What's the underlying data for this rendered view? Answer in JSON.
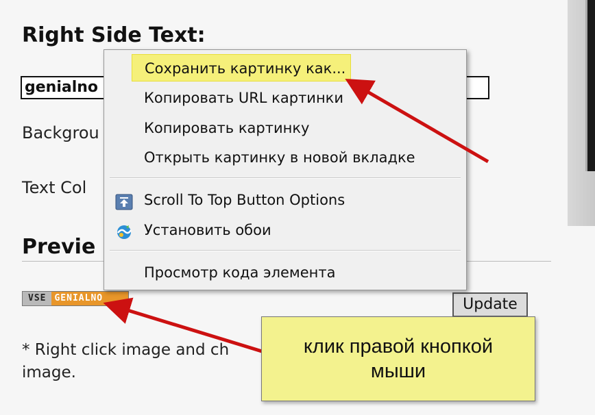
{
  "form": {
    "right_side_heading": "Right Side Text:",
    "right_side_value": "genialno",
    "background_label": "Backgrou",
    "text_color_label": "Text Col",
    "preview_heading": "Previe",
    "badge_left": "VSE",
    "badge_right": "GENIALNO",
    "update_label": "Update",
    "note_text": "* Right click image and ch image."
  },
  "context_menu": {
    "items": [
      {
        "label": "Сохранить картинку как...",
        "highlighted": true
      },
      {
        "label": "Копировать URL картинки"
      },
      {
        "label": "Копировать картинку"
      },
      {
        "label": "Открыть картинку в новой вкладке"
      },
      {
        "label": "Scroll To Top Button Options",
        "icon": "scroll-to-top-icon"
      },
      {
        "label": "Установить обои",
        "icon": "wallpaper-icon"
      },
      {
        "label": "Просмотр кода элемента"
      }
    ]
  },
  "annotation": {
    "line1": "клик правой кнопкой",
    "line2": "мыши"
  },
  "colors": {
    "highlight": "#f5f07a",
    "callout": "#f3f28e",
    "arrow": "#cc1111",
    "badge_orange": "#e8962a"
  }
}
